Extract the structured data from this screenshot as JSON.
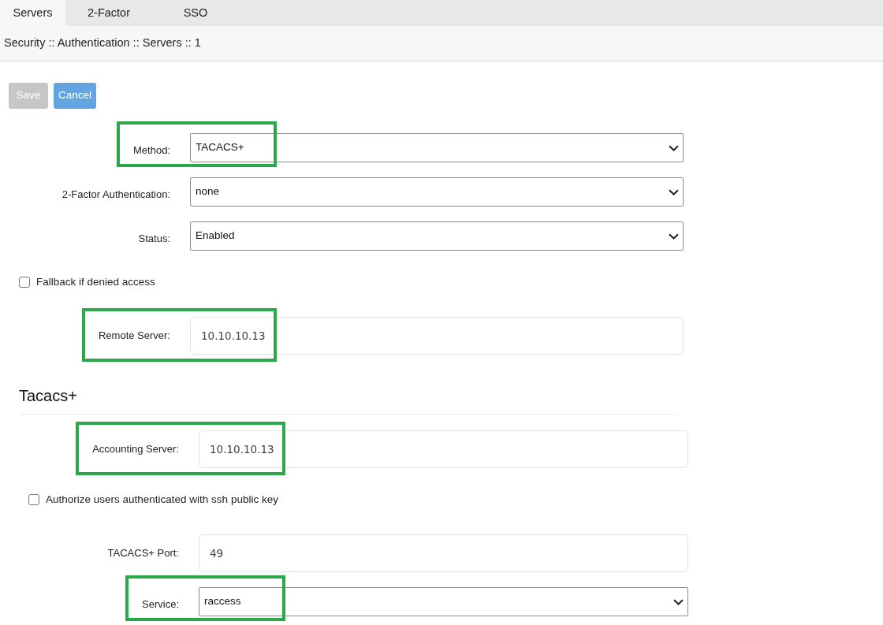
{
  "tabs": [
    {
      "label": "Servers",
      "selected": true
    },
    {
      "label": "2-Factor",
      "selected": false
    },
    {
      "label": "SSO",
      "selected": false
    }
  ],
  "breadcrumb": "Security :: Authentication :: Servers :: 1",
  "buttons": [
    {
      "label": "Save",
      "disabled": true
    },
    {
      "label": "Cancel",
      "disabled": false
    }
  ],
  "general": [
    {
      "kind": "select",
      "label": "Method:",
      "value": "TACACS+",
      "highlighted": true
    },
    {
      "kind": "select",
      "label": "2-Factor Authentication:",
      "value": "none",
      "highlighted": false
    },
    {
      "kind": "select",
      "label": "Status:",
      "value": "Enabled",
      "highlighted": false
    },
    {
      "kind": "checkbox",
      "label": "Fallback if denied access",
      "checked": false
    },
    {
      "kind": "text",
      "label": "Remote Server:",
      "value": "10.10.10.13",
      "highlighted": true
    }
  ],
  "section": {
    "title": "Tacacs+",
    "rows": [
      {
        "kind": "text",
        "label": "Accounting Server:",
        "value": "10.10.10.13",
        "highlighted": true
      },
      {
        "kind": "checkbox",
        "label": "Authorize users authenticated with ssh public key",
        "checked": false
      },
      {
        "kind": "text",
        "label": "TACACS+ Port:",
        "value": "49",
        "highlighted": false
      },
      {
        "kind": "select",
        "label": "Service:",
        "value": "raccess",
        "highlighted": true
      }
    ]
  }
}
